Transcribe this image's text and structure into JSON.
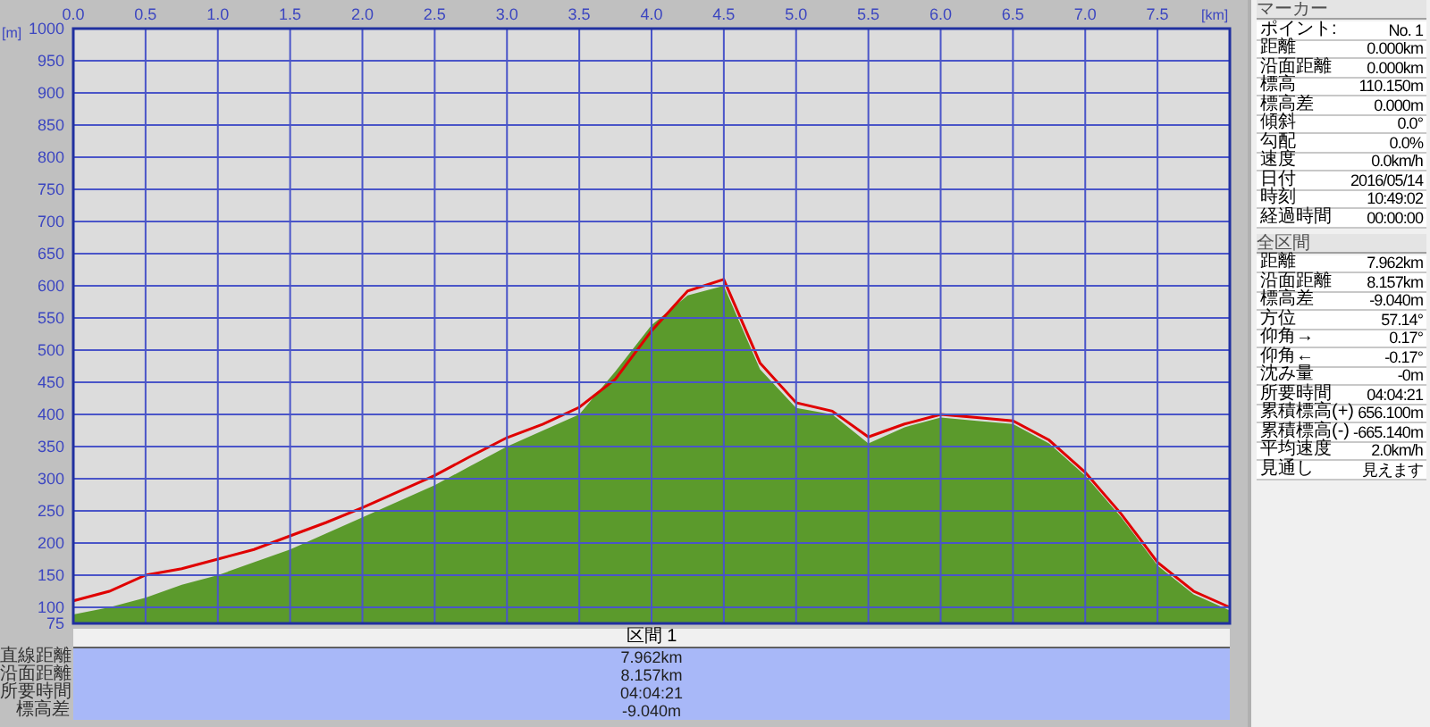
{
  "chart": {
    "chart_data": {
      "type": "area",
      "xlabel": "[km]",
      "ylabel": "[m]",
      "x": [
        0,
        0.25,
        0.5,
        0.75,
        1,
        1.25,
        1.5,
        1.75,
        2,
        2.25,
        2.5,
        2.75,
        3,
        3.25,
        3.5,
        3.75,
        4,
        4.25,
        4.5,
        4.75,
        5,
        5.25,
        5.5,
        5.75,
        6,
        6.25,
        6.5,
        6.75,
        7,
        7.25,
        7.5,
        7.75,
        8
      ],
      "series": [
        {
          "color": "#5b9a2c",
          "values": [
            89,
            100,
            115,
            135,
            150,
            170,
            190,
            215,
            240,
            265,
            290,
            320,
            350,
            375,
            400,
            467,
            539,
            585,
            600,
            470,
            410,
            400,
            355,
            380,
            395,
            390,
            385,
            355,
            305,
            240,
            165,
            120,
            95
          ]
        },
        {
          "type": "line",
          "color": "#e00000",
          "values": [
            110,
            125,
            150,
            160,
            175,
            190,
            211,
            232,
            255,
            280,
            305,
            335,
            364,
            385,
            411,
            455,
            530,
            592,
            610,
            480,
            418,
            405,
            365,
            385,
            400,
            395,
            390,
            360,
            310,
            245,
            170,
            125,
            100
          ]
        }
      ],
      "xlim": [
        0,
        8
      ],
      "ylim": [
        75,
        1000
      ],
      "grid": true,
      "xticks": [
        {
          "value": 0,
          "label": "0.0"
        },
        {
          "value": 0.5,
          "label": "0.5"
        },
        {
          "value": 1,
          "label": "1.0"
        },
        {
          "value": 1.5,
          "label": "1.5"
        },
        {
          "value": 2,
          "label": "2.0"
        },
        {
          "value": 2.5,
          "label": "2.5"
        },
        {
          "value": 3,
          "label": "3.0"
        },
        {
          "value": 3.5,
          "label": "3.5"
        },
        {
          "value": 4,
          "label": "4.0"
        },
        {
          "value": 4.5,
          "label": "4.5"
        },
        {
          "value": 5,
          "label": "5.0"
        },
        {
          "value": 5.5,
          "label": "5.5"
        },
        {
          "value": 6,
          "label": "6.0"
        },
        {
          "value": 6.5,
          "label": "6.5"
        },
        {
          "value": 7,
          "label": "7.0"
        },
        {
          "value": 7.5,
          "label": "7.5"
        }
      ],
      "yticks": [
        75,
        100,
        150,
        200,
        250,
        300,
        350,
        400,
        450,
        500,
        550,
        600,
        650,
        700,
        750,
        800,
        850,
        900,
        950,
        1000
      ]
    }
  },
  "section_table": {
    "header": "区間 1",
    "rows": [
      {
        "label": "直線距離",
        "value": "7.962km"
      },
      {
        "label": "沿面距離",
        "value": "8.157km"
      },
      {
        "label": "所要時間",
        "value": "04:04:21"
      },
      {
        "label": "標高差",
        "value": "-9.040m"
      }
    ]
  },
  "side_panel": {
    "groups": [
      {
        "title": "マーカー",
        "rows": [
          {
            "label": "ポイント:",
            "value": "No. 1"
          },
          {
            "label": "距離",
            "value": "0.000km"
          },
          {
            "label": "沿面距離",
            "value": "0.000km"
          },
          {
            "label": "標高",
            "value": "110.150m"
          },
          {
            "label": "標高差",
            "value": "0.000m"
          },
          {
            "label": "傾斜",
            "value": "0.0°"
          },
          {
            "label": "勾配",
            "value": "0.0%"
          },
          {
            "label": "速度",
            "value": "0.0km/h"
          },
          {
            "label": "日付",
            "value": "2016/05/14"
          },
          {
            "label": "時刻",
            "value": "10:49:02"
          },
          {
            "label": "経過時間",
            "value": "00:00:00"
          }
        ]
      },
      {
        "title": "全区間",
        "rows": [
          {
            "label": "距離",
            "value": "7.962km"
          },
          {
            "label": "沿面距離",
            "value": "8.157km"
          },
          {
            "label": "標高差",
            "value": "-9.040m"
          },
          {
            "label": "方位",
            "value": "57.14°"
          },
          {
            "label": "仰角→",
            "value": "0.17°"
          },
          {
            "label": "仰角←",
            "value": "-0.17°"
          },
          {
            "label": "沈み量",
            "value": "-0m"
          },
          {
            "label": "所要時間",
            "value": "04:04:21"
          },
          {
            "label": "累積標高(+)",
            "value": "656.100m"
          },
          {
            "label": "累積標高(-)",
            "value": "-665.140m"
          },
          {
            "label": "平均速度",
            "value": "2.0km/h"
          },
          {
            "label": "見通し",
            "value": "見えます"
          }
        ]
      }
    ]
  }
}
